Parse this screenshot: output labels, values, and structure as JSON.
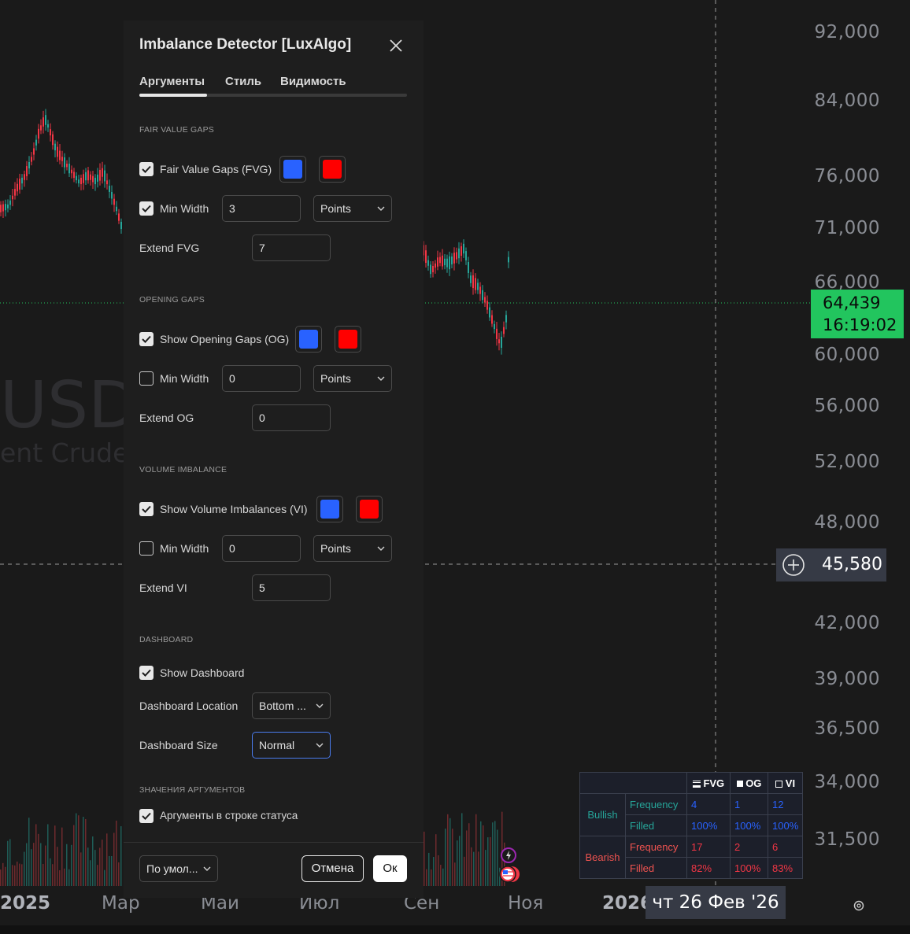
{
  "chart": {
    "price_ticks": [
      "92,000",
      "84,000",
      "76,000",
      "71,000",
      "66,000",
      "60,000",
      "56,000",
      "52,000",
      "48,000",
      "42,000",
      "39,000",
      "36,500",
      "34,000",
      "31,500"
    ],
    "time_ticks": [
      "2025",
      "Мар",
      "Май",
      "Июл",
      "Сен",
      "Ноя",
      "2026"
    ],
    "symbol_watermark": "USD",
    "symbol_description": "ent Crude",
    "last_price": "64,439",
    "countdown": "16:19:02",
    "crosshair_price": "45,580",
    "crosshair_date": "чт 26 Фев '26",
    "colors": {
      "up": "#26a69a",
      "down": "#f23645",
      "last_price_bg": "#22c55e"
    }
  },
  "dashboard": {
    "headers": [
      "FVG",
      "OG",
      "VI"
    ],
    "bullish_label": "Bullish",
    "bearish_label": "Bearish",
    "frequency_label": "Frequency",
    "filled_label": "Filled",
    "bullish": {
      "frequency": [
        "4",
        "1",
        "12"
      ],
      "filled": [
        "100%",
        "100%",
        "100%"
      ]
    },
    "bearish": {
      "frequency": [
        "17",
        "2",
        "6"
      ],
      "filled": [
        "82%",
        "100%",
        "83%"
      ]
    }
  },
  "dialog": {
    "title": "Imbalance Detector [LuxAlgo]",
    "tabs": [
      "Аргументы",
      "Стиль",
      "Видимость"
    ],
    "active_tab": "Аргументы",
    "fvg": {
      "section": "FAIR VALUE GAPS",
      "show_label": "Fair Value Gaps (FVG)",
      "show_checked": true,
      "bull_color": "#2962ff",
      "bear_color": "#ff0000",
      "min_width_label": "Min Width",
      "min_width_checked": true,
      "min_width_value": "3",
      "min_width_unit": "Points",
      "extend_label": "Extend FVG",
      "extend_value": "7"
    },
    "og": {
      "section": "OPENING GAPS",
      "show_label": "Show Opening Gaps (OG)",
      "show_checked": true,
      "bull_color": "#2962ff",
      "bear_color": "#ff0000",
      "min_width_label": "Min Width",
      "min_width_checked": false,
      "min_width_value": "0",
      "min_width_unit": "Points",
      "extend_label": "Extend OG",
      "extend_value": "0"
    },
    "vi": {
      "section": "VOLUME IMBALANCE",
      "show_label": "Show Volume Imbalances (VI)",
      "show_checked": true,
      "bull_color": "#2962ff",
      "bear_color": "#ff0000",
      "min_width_label": "Min Width",
      "min_width_checked": false,
      "min_width_value": "0",
      "min_width_unit": "Points",
      "extend_label": "Extend VI",
      "extend_value": "5"
    },
    "dash": {
      "section": "DASHBOARD",
      "show_label": "Show Dashboard",
      "show_checked": true,
      "location_label": "Dashboard Location",
      "location_value": "Bottom ...",
      "size_label": "Dashboard Size",
      "size_value": "Normal"
    },
    "inputs": {
      "section": "ЗНАЧЕНИЯ АРГУМЕНТОВ",
      "status_line_label": "Аргументы в строке статуса",
      "status_line_checked": true
    },
    "footer": {
      "defaults": "По умол...",
      "cancel": "Отмена",
      "ok": "Ок"
    }
  }
}
